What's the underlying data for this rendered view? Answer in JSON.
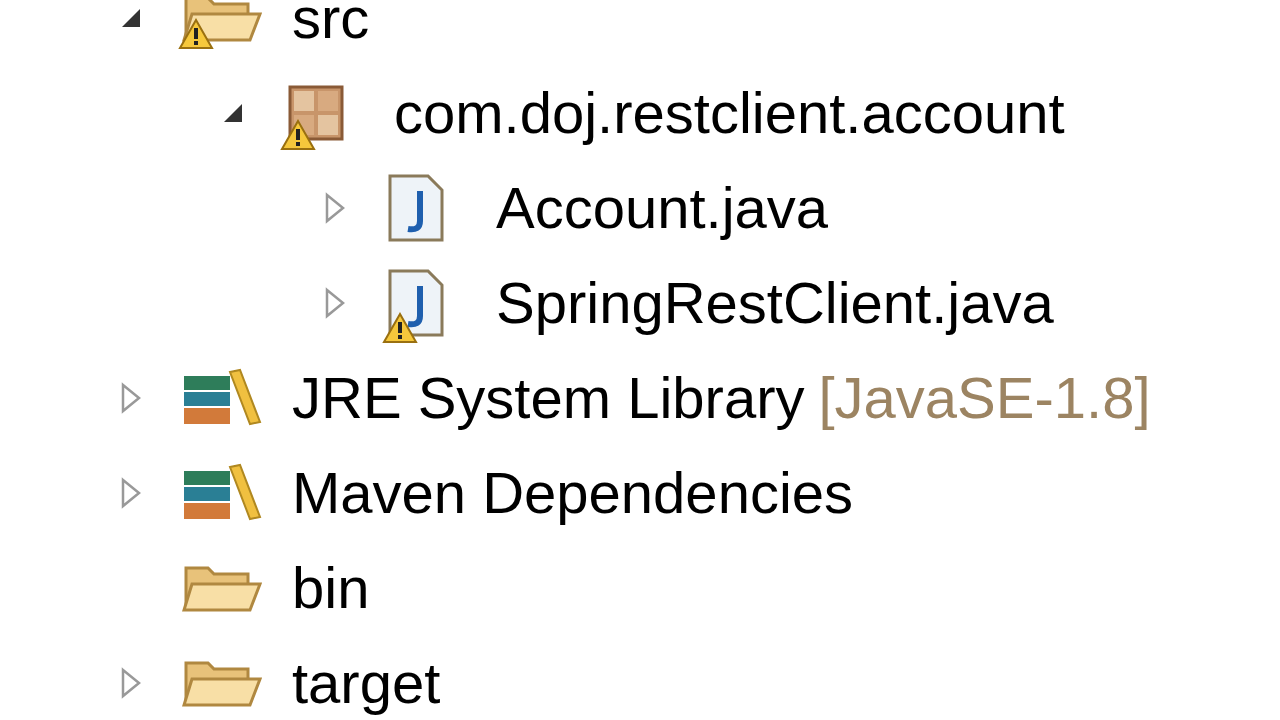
{
  "tree": [
    {
      "label": "src",
      "kind": "source-folder",
      "warning": true,
      "expandable": true,
      "expanded": true,
      "children": [
        {
          "label": "com.doj.restclient.account",
          "kind": "package",
          "warning": true,
          "expandable": true,
          "expanded": true,
          "children": [
            {
              "label": "Account.java",
              "kind": "java-file",
              "warning": false,
              "expandable": true,
              "expanded": false
            },
            {
              "label": "SpringRestClient.java",
              "kind": "java-file",
              "warning": true,
              "expandable": true,
              "expanded": false
            }
          ]
        }
      ]
    },
    {
      "label": "JRE System Library",
      "decoration": "[JavaSE-1.8]",
      "kind": "library",
      "warning": false,
      "expandable": true,
      "expanded": false
    },
    {
      "label": "Maven Dependencies",
      "kind": "library",
      "warning": false,
      "expandable": true,
      "expanded": false
    },
    {
      "label": "bin",
      "kind": "folder",
      "warning": false,
      "expandable": false
    },
    {
      "label": "target",
      "kind": "folder",
      "warning": false,
      "expandable": true,
      "expanded": false
    }
  ]
}
